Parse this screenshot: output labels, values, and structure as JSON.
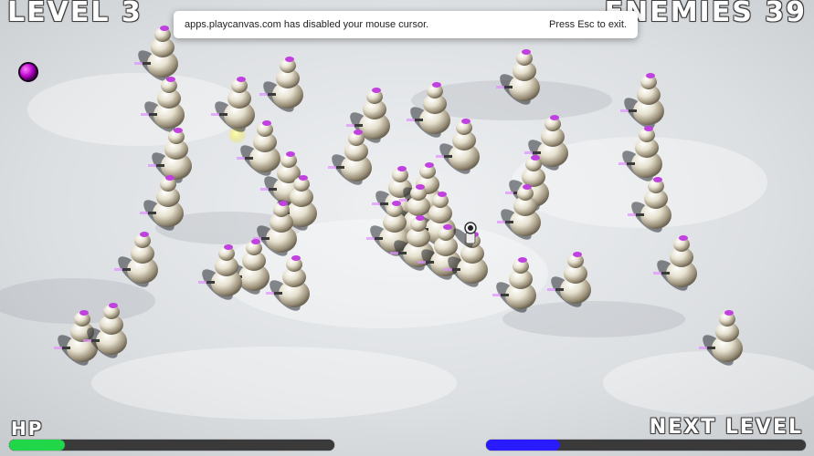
{
  "hud": {
    "level_label": "LEVEL 3",
    "enemies_label": "ENEMIES 39",
    "hp_label": "HP",
    "next_level_label": "NEXT LEVEL",
    "hp_fraction": 0.17,
    "next_level_fraction": 0.23,
    "hp_color": "#22d64a",
    "xp_color": "#2a1bff"
  },
  "notice": {
    "message": "apps.playcanvas.com has disabled your mouse cursor.",
    "hint": "Press Esc to exit."
  },
  "scene": {
    "ground": "snow",
    "enemy_type": "snowman",
    "player": "astronaut-snowman",
    "pickups": [
      "purple-orb",
      "yellow-orb"
    ]
  }
}
